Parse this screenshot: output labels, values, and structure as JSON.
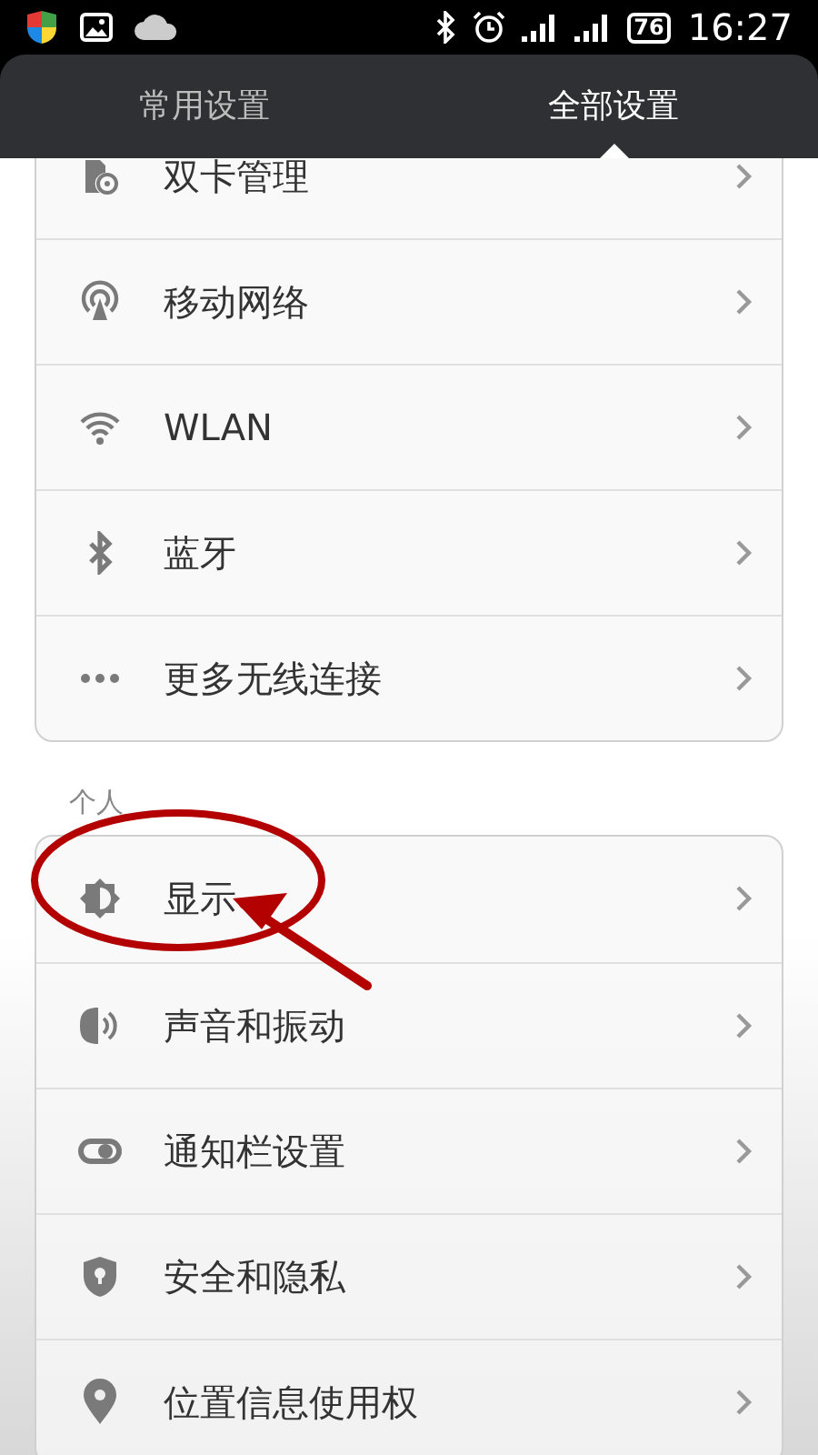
{
  "status_bar": {
    "battery": "76",
    "time": "16:27"
  },
  "tabs": [
    {
      "label": "常用设置",
      "selected": false
    },
    {
      "label": "全部设置",
      "selected": true
    }
  ],
  "sections": [
    {
      "items": [
        {
          "label": "双卡管理"
        },
        {
          "label": "移动网络"
        },
        {
          "label": "WLAN"
        },
        {
          "label": "蓝牙"
        },
        {
          "label": "更多无线连接"
        }
      ]
    },
    {
      "header": "个人",
      "items": [
        {
          "label": "显示"
        },
        {
          "label": "声音和振动"
        },
        {
          "label": "通知栏设置"
        },
        {
          "label": "安全和隐私"
        },
        {
          "label": "位置信息使用权"
        }
      ]
    }
  ]
}
